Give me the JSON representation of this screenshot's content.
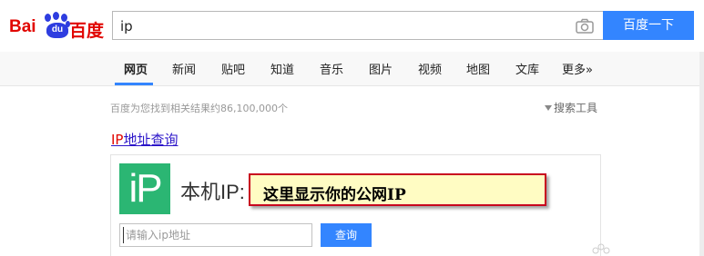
{
  "logo": {
    "bai": "Bai",
    "du": "du",
    "baidu_cn": "百度"
  },
  "search": {
    "value": "ip",
    "button_label": "百度一下"
  },
  "tabs": [
    {
      "label": "网页",
      "active": true
    },
    {
      "label": "新闻"
    },
    {
      "label": "贴吧"
    },
    {
      "label": "知道"
    },
    {
      "label": "音乐"
    },
    {
      "label": "图片"
    },
    {
      "label": "视频"
    },
    {
      "label": "地图"
    },
    {
      "label": "文库"
    },
    {
      "label": "更多»"
    }
  ],
  "results": {
    "count_text": "百度为您找到相关结果约86,100,000个",
    "tools_label": "搜索工具",
    "title_highlight": "IP",
    "title_rest": "地址查询",
    "icon_text": "iP",
    "local_ip_label": "本机IP:",
    "callout_text": "这里显示你的公网IP",
    "ip_input_placeholder": "请输入ip地址",
    "query_button": "查询"
  },
  "colors": {
    "brand_red": "#e10601",
    "brand_blue": "#2e3de0",
    "button_blue": "#3385ff",
    "icon_green": "#2bb673",
    "link": "#2b14c9",
    "callout_border": "#c8001e",
    "callout_bg": "#fffcc3"
  }
}
